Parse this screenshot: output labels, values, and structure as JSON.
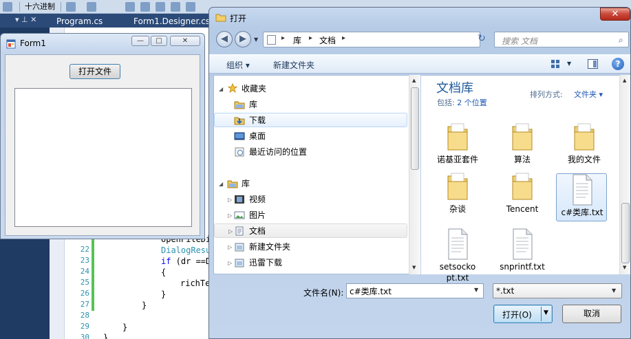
{
  "ide": {
    "toolbar": {
      "hex_label": "十六进制"
    },
    "tabs": [
      "Program.cs",
      "Form1.Designer.cs"
    ],
    "pin_glyphs": "▾ ⊥ ✕",
    "line_numbers": [
      "22",
      "23",
      "24",
      "25",
      "26",
      "27",
      "28",
      "29",
      "30"
    ],
    "code": {
      "line21": "openFileDi",
      "line22": "DialogResu",
      "line23_kw": "if",
      "line23": " (dr ==D",
      "line24": "{",
      "line25": "richTe",
      "line26": "}",
      "line27": "}",
      "line29": "}",
      "line30": "}"
    }
  },
  "form1": {
    "title": "Form1",
    "minimize": "—",
    "maximize": "□",
    "close": "✕",
    "open_button": "打开文件"
  },
  "dialog": {
    "title": "打开",
    "close": "✕",
    "back": "◀",
    "forward": "▶",
    "breadcrumb": [
      "库",
      "文档"
    ],
    "breadcrumb_sep": "▸",
    "search_placeholder": "搜索 文档",
    "refresh": "↻",
    "commands": {
      "organize": "组织 ▾",
      "new_folder": "新建文件夹",
      "help": "?"
    },
    "tree": {
      "favorites": "收藏夹",
      "fav_items": [
        "库",
        "下载",
        "桌面",
        "最近访问的位置"
      ],
      "libraries": "库",
      "lib_items": [
        "视频",
        "图片",
        "文档",
        "新建文件夹",
        "迅雷下载"
      ]
    },
    "content": {
      "title": "文档库",
      "includes_prefix": "包括:",
      "includes_link": "2 个位置",
      "sort_label": "排列方式:",
      "sort_value": "文件夹 ▾",
      "files": [
        {
          "name": "诺基亚套件",
          "kind": "folder"
        },
        {
          "name": "算法",
          "kind": "folder"
        },
        {
          "name": "我的文件",
          "kind": "folder"
        },
        {
          "name": "杂谈",
          "kind": "folder"
        },
        {
          "name": "Tencent",
          "kind": "folder"
        },
        {
          "name": "c#类库.txt",
          "kind": "text"
        },
        {
          "name": "setsockopt.txt",
          "kind": "text"
        },
        {
          "name": "snprintf.txt",
          "kind": "text"
        }
      ]
    },
    "filename_label": "文件名(N):",
    "filename_value": "c#类库.txt",
    "filter_value": "*.txt",
    "open_button": "打开(O)",
    "cancel_button": "取消"
  },
  "colors": {
    "accent": "#1e5a9c",
    "selection": "#d6e8fc",
    "close_red": "#c9473a"
  }
}
